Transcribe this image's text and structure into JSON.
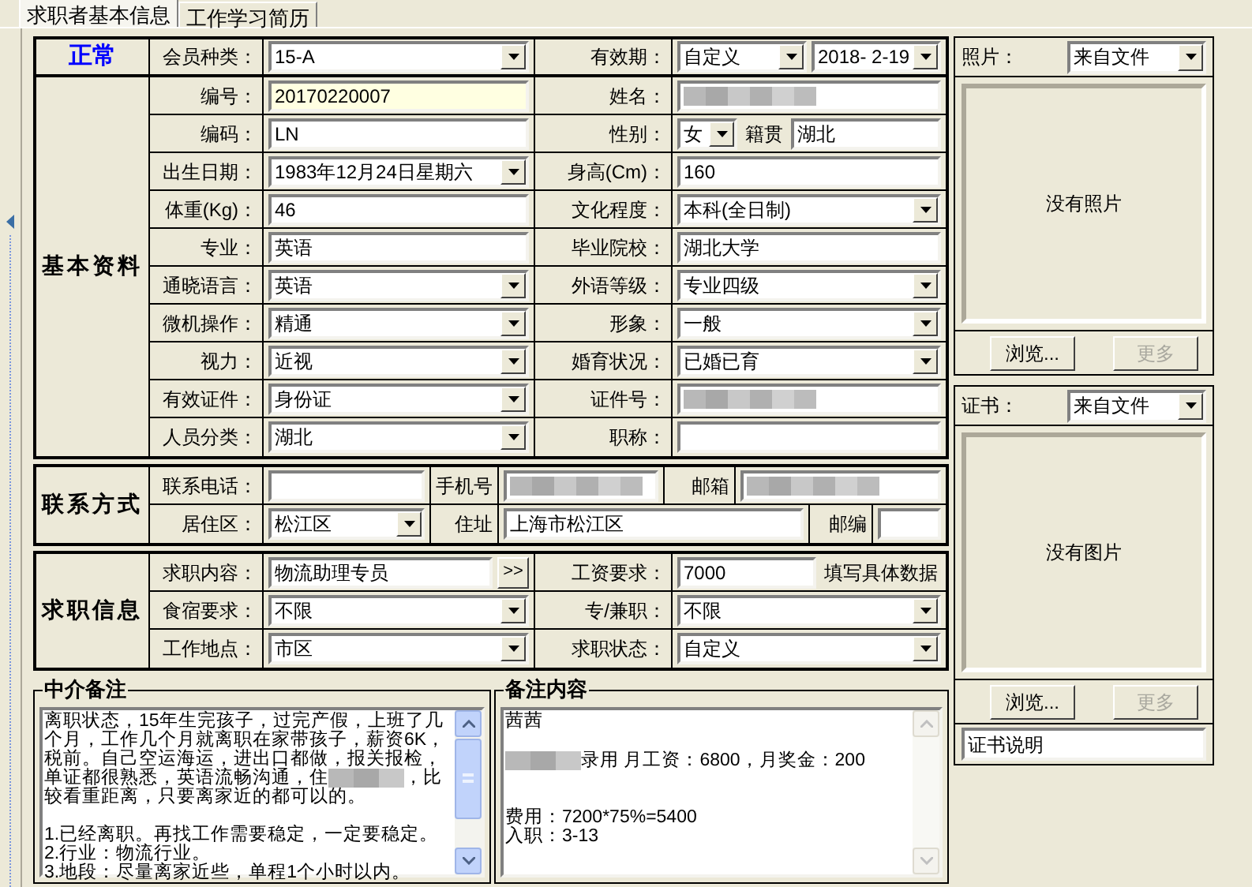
{
  "tabs": [
    {
      "label": "求职者基本信息",
      "selected": true
    },
    {
      "label": "工作学习简历",
      "selected": false
    }
  ],
  "status": {
    "label": "正常"
  },
  "basic": {
    "title": "基本资料",
    "header": {
      "left": {
        "label": "会员种类：",
        "items": [
          {
            "kind": "select",
            "value": "15-A"
          }
        ]
      },
      "right": {
        "label": "有效期：",
        "items": [
          {
            "kind": "select",
            "value": "自定义"
          },
          {
            "kind": "select",
            "value": "2018- 2-19"
          }
        ]
      }
    },
    "rows": [
      {
        "left": {
          "label": "编号：",
          "items": [
            {
              "kind": "id_input",
              "value": "20170220007"
            }
          ]
        },
        "right": {
          "label": "姓名：",
          "items": [
            {
              "kind": "blurred"
            }
          ]
        }
      },
      {
        "left": {
          "label": "编码：",
          "items": [
            {
              "kind": "input",
              "value": "LN"
            }
          ]
        },
        "right": {
          "label": "性别：",
          "items": [
            {
              "kind": "small_select",
              "value": "女"
            },
            {
              "kind": "caption",
              "value": "籍贯"
            },
            {
              "kind": "input",
              "value": "湖北"
            }
          ]
        }
      },
      {
        "left": {
          "label": "出生日期：",
          "items": [
            {
              "kind": "select",
              "value": "1983年12月24日星期六"
            }
          ]
        },
        "right": {
          "label": "身高(Cm)：",
          "items": [
            {
              "kind": "input",
              "value": "160"
            }
          ]
        }
      },
      {
        "left": {
          "label": "体重(Kg)：",
          "items": [
            {
              "kind": "input",
              "value": "46"
            }
          ]
        },
        "right": {
          "label": "文化程度：",
          "items": [
            {
              "kind": "select",
              "value": "本科(全日制)"
            }
          ]
        }
      },
      {
        "left": {
          "label": "专业：",
          "items": [
            {
              "kind": "input",
              "value": "英语"
            }
          ]
        },
        "right": {
          "label": "毕业院校：",
          "items": [
            {
              "kind": "input",
              "value": "湖北大学"
            }
          ]
        }
      },
      {
        "left": {
          "label": "通晓语言：",
          "items": [
            {
              "kind": "select",
              "value": "英语"
            }
          ]
        },
        "right": {
          "label": "外语等级：",
          "items": [
            {
              "kind": "select",
              "value": "专业四级"
            }
          ]
        }
      },
      {
        "left": {
          "label": "微机操作：",
          "items": [
            {
              "kind": "select",
              "value": "精通"
            }
          ]
        },
        "right": {
          "label": "形象：",
          "items": [
            {
              "kind": "select",
              "value": "一般"
            }
          ]
        }
      },
      {
        "left": {
          "label": "视力：",
          "items": [
            {
              "kind": "select",
              "value": "近视"
            }
          ]
        },
        "right": {
          "label": "婚育状况：",
          "items": [
            {
              "kind": "select",
              "value": "已婚已育"
            }
          ]
        }
      },
      {
        "left": {
          "label": "有效证件：",
          "items": [
            {
              "kind": "select",
              "value": "身份证"
            }
          ]
        },
        "right": {
          "label": "证件号：",
          "items": [
            {
              "kind": "blurred"
            }
          ]
        }
      },
      {
        "left": {
          "label": "人员分类：",
          "items": [
            {
              "kind": "select",
              "value": "湖北"
            }
          ]
        },
        "right": {
          "label": "职称：",
          "items": [
            {
              "kind": "input"
            }
          ]
        }
      }
    ]
  },
  "contact": {
    "title": "联系方式",
    "rows": [
      [
        {
          "label": "联系电话：",
          "items": [
            {
              "kind": "input"
            }
          ]
        },
        {
          "label": "手机号",
          "items": [
            {
              "kind": "blurred"
            }
          ]
        },
        {
          "label": "邮箱",
          "items": [
            {
              "kind": "blurred"
            }
          ]
        }
      ],
      [
        {
          "label": "居住区：",
          "items": [
            {
              "kind": "select",
              "value": "松江区"
            }
          ]
        },
        {
          "label": "住址",
          "items": [
            {
              "kind": "input",
              "value": "上海市松江区"
            }
          ]
        },
        {
          "label": "邮编",
          "items": [
            {
              "kind": "input"
            }
          ]
        }
      ]
    ]
  },
  "job": {
    "title": "求职信息",
    "rows": [
      {
        "left": {
          "label": "求职内容：",
          "items": [
            {
              "kind": "input",
              "value": "物流助理专员"
            },
            {
              "kind": "more_button",
              "value": ">>"
            }
          ]
        },
        "right": {
          "label": "工资要求：",
          "items": [
            {
              "kind": "input",
              "value": "7000"
            },
            {
              "kind": "caption",
              "value": "填写具体数据"
            }
          ]
        }
      },
      {
        "left": {
          "label": "食宿要求：",
          "items": [
            {
              "kind": "select",
              "value": "不限"
            }
          ]
        },
        "right": {
          "label": "专/兼职：",
          "items": [
            {
              "kind": "select",
              "value": "不限"
            }
          ]
        }
      },
      {
        "left": {
          "label": "工作地点：",
          "items": [
            {
              "kind": "select",
              "value": "市区"
            }
          ]
        },
        "right": {
          "label": "求职状态：",
          "items": [
            {
              "kind": "select",
              "value": "自定义"
            }
          ]
        }
      }
    ]
  },
  "agency_notes": {
    "title": "中介备注",
    "blocks": [
      {
        "parts": [
          {
            "kind": "text",
            "text": "离职状态，15年生完孩子，过完产假，上班了几个月，工作几个月就离职在家带孩子，薪资6K，税前。自己空运海运，进出口都做，报关报检，单证都很熟悉，英语流畅沟通，住"
          },
          {
            "kind": "blurred"
          },
          {
            "kind": "text",
            "text": "，比较看重距离，只要离家近的都可以的。"
          }
        ]
      },
      {
        "lines": [
          "1.已经离职。再找工作需要稳定，一定要稳定。",
          "2.行业：物流行业。",
          "3.地段：尽量离家近些，单程1个小时以内。"
        ]
      }
    ]
  },
  "memo": {
    "title": "备注内容",
    "blocks": [
      {
        "parts": [
          {
            "kind": "text",
            "text": "茜茜"
          }
        ]
      },
      {
        "parts": [
          {
            "kind": "blurred"
          },
          {
            "kind": "text",
            "text": "录用 月工资：6800，月奖金：200"
          }
        ]
      },
      {
        "lines": [
          "费用：7200*75%=5400",
          "入职：3-13"
        ]
      }
    ]
  },
  "photo": {
    "label": "照片：",
    "source": "来自文件",
    "empty_text": "没有照片",
    "buttons": [
      {
        "label": "浏览...",
        "disabled": false
      },
      {
        "label": "更多",
        "disabled": true
      }
    ]
  },
  "certificate": {
    "label": "证书：",
    "source": "来自文件",
    "empty_text": "没有图片",
    "buttons": [
      {
        "label": "浏览...",
        "disabled": false
      },
      {
        "label": "更多",
        "disabled": true
      }
    ],
    "description": "证书说明"
  }
}
